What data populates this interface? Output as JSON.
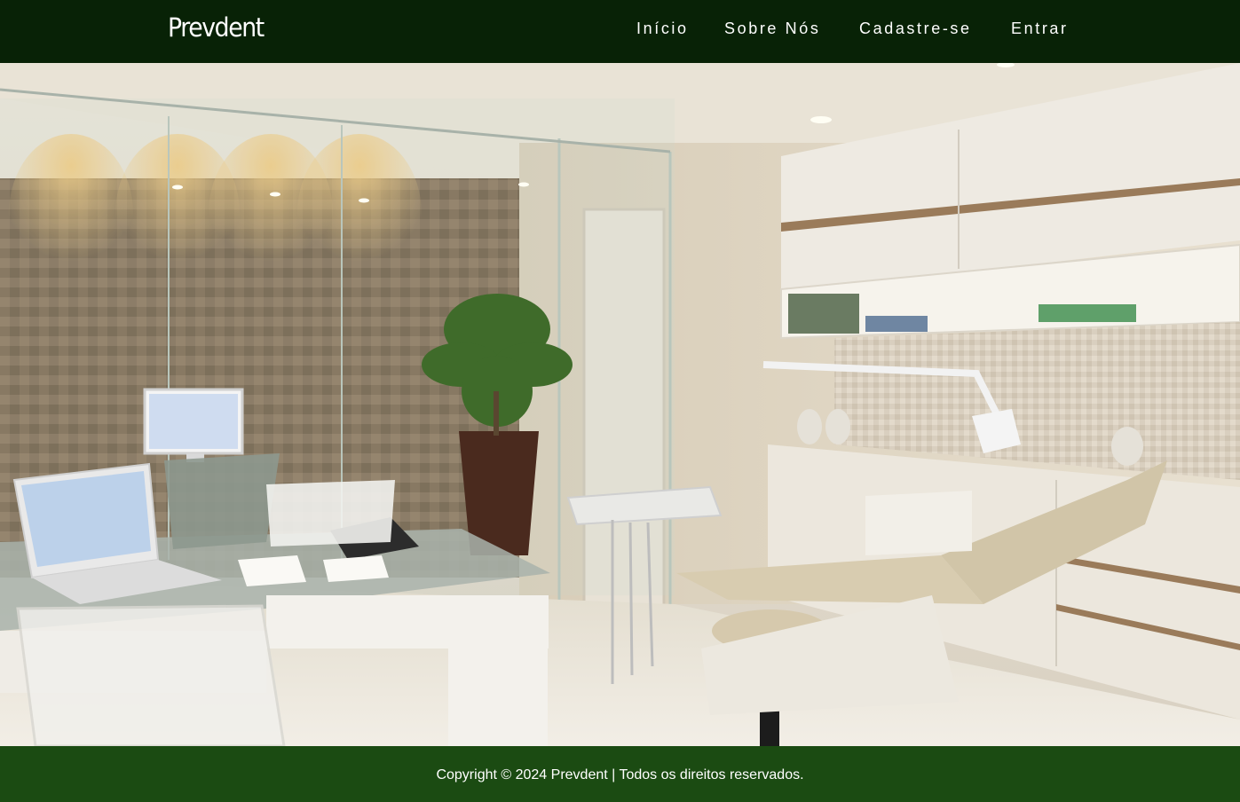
{
  "header": {
    "brand": "Prevdent",
    "nav": [
      {
        "label": "Início"
      },
      {
        "label": "Sobre Nós"
      },
      {
        "label": "Cadastre-se"
      },
      {
        "label": "Entrar"
      }
    ]
  },
  "hero": {
    "image_subject": "dental-office-interior"
  },
  "footer": {
    "copyright": "Copyright © 2024 Prevdent | Todos os direitos reservados."
  },
  "colors": {
    "header_bg": "#082206",
    "footer_bg": "#1b4b12",
    "text": "#ffffff"
  }
}
